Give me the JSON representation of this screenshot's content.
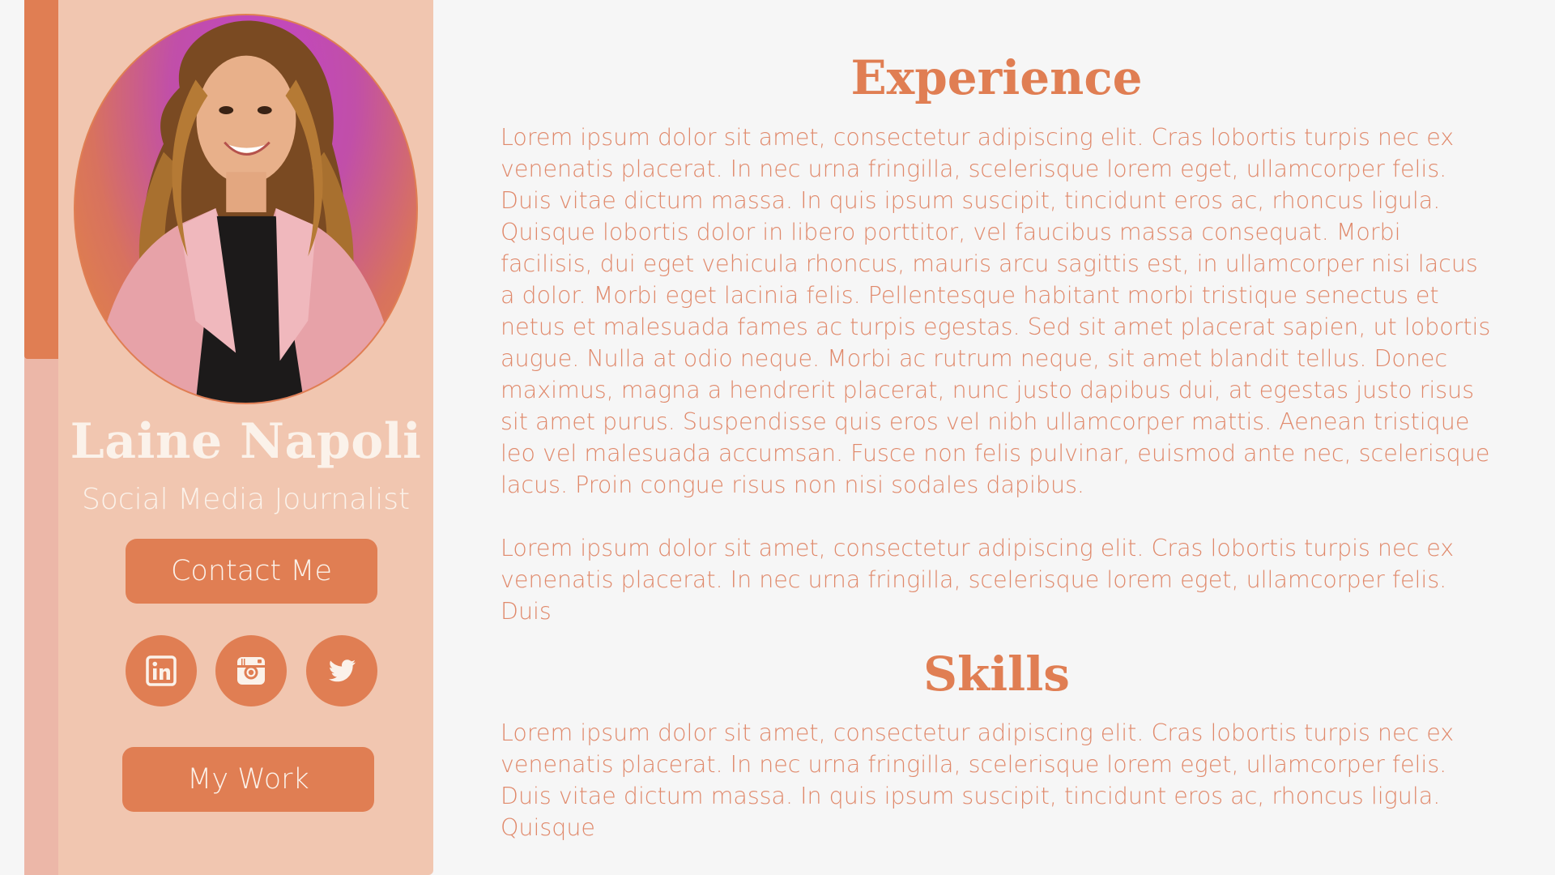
{
  "profile": {
    "name": "Laine Napoli",
    "title": "Social Media Journalist",
    "photo_icon": "person-portrait"
  },
  "buttons": {
    "contact_label": "Contact Me",
    "work_label": "My Work"
  },
  "social": [
    {
      "name": "LinkedIn",
      "icon": "linkedin-icon"
    },
    {
      "name": "Instagram",
      "icon": "instagram-icon"
    },
    {
      "name": "Twitter",
      "icon": "twitter-icon"
    }
  ],
  "experience": {
    "heading": "Experience",
    "paragraphs": [
      "Lorem ipsum dolor sit amet, consectetur adipiscing elit. Cras lobortis turpis nec ex venenatis placerat. In nec urna fringilla, scelerisque lorem eget, ullamcorper felis. Duis vitae dictum massa. In quis ipsum suscipit, tincidunt eros ac, rhoncus ligula. Quisque lobortis dolor in libero porttitor, vel faucibus massa consequat. Morbi facilisis, dui eget vehicula rhoncus, mauris arcu sagittis est, in ullamcorper nisi lacus a dolor. Morbi eget lacinia felis. Pellentesque habitant morbi tristique senectus et netus et malesuada fames ac turpis egestas. Sed sit amet placerat sapien, ut lobortis augue. Nulla at odio neque. Morbi ac rutrum neque, sit amet blandit tellus. Donec maximus, magna a hendrerit placerat, nunc justo dapibus dui, at egestas justo risus sit amet purus. Suspendisse quis eros vel nibh ullamcorper mattis. Aenean tristique leo vel malesuada accumsan. Fusce non felis pulvinar, euismod ante nec, scelerisque lacus. Proin congue risus non nisi sodales dapibus.",
      "Lorem ipsum dolor sit amet, consectetur adipiscing elit. Cras lobortis turpis nec ex venenatis placerat. In nec urna fringilla, scelerisque lorem eget, ullamcorper felis. Duis"
    ]
  },
  "skills": {
    "heading": "Skills",
    "paragraph": "Lorem ipsum dolor sit amet, consectetur adipiscing elit. Cras lobortis turpis nec ex venenatis placerat. In nec urna fringilla, scelerisque lorem eget, ullamcorper felis. Duis vitae dictum massa. In quis ipsum suscipit, tincidunt eros ac, rhoncus ligula. Quisque"
  },
  "colors": {
    "accent": "#e07e53",
    "sidebar_bg": "#f1c6b0",
    "strip_light": "#ecb7a8",
    "text_body": "#e0896b",
    "text_light": "#fbf2ea",
    "page_bg": "#f6f6f6"
  }
}
